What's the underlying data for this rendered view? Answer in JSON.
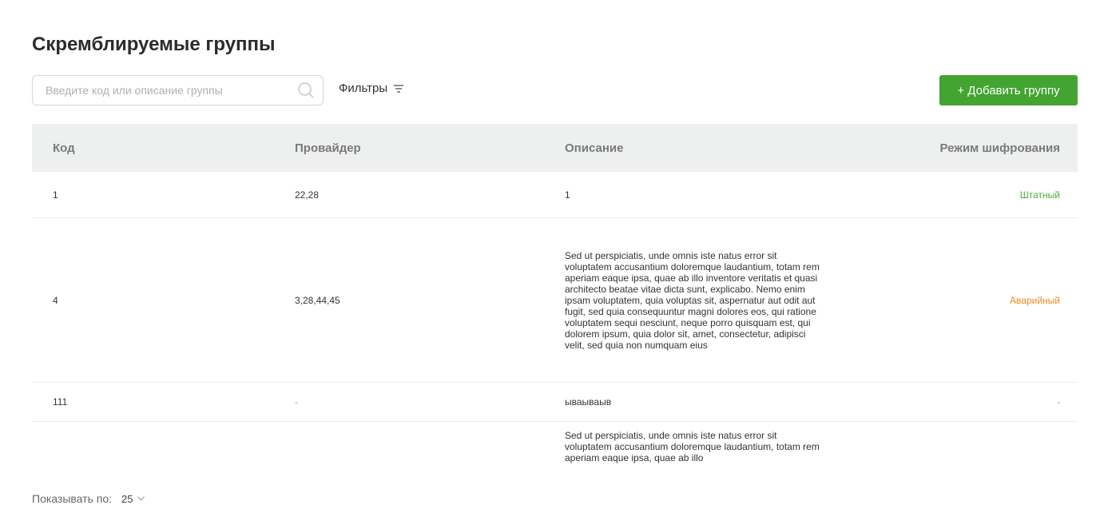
{
  "page": {
    "title": "Скремблируемые группы"
  },
  "toolbar": {
    "search_placeholder": "Введите код или описание группы",
    "filters_label": "Фильтры",
    "add_button_label": "+ Добавить группу"
  },
  "table": {
    "columns": [
      "Код",
      "Провайдер",
      "Описание",
      "Режим шифрования"
    ],
    "rows": [
      {
        "code": "1",
        "provider": "22,28",
        "description": "1",
        "mode": "Штатный"
      },
      {
        "code": "4",
        "provider": "3,28,44,45",
        "description": "Sed ut perspiciatis, unde omnis iste natus error sit voluptatem accusantium doloremque laudantium, totam rem aperiam eaque ipsa, quae ab illo inventore veritatis et quasi architecto beatae vitae dicta sunt, explicabo. Nemo enim ipsam voluptatem, quia voluptas sit, aspernatur aut odit aut fugit, sed quia consequuntur magni dolores eos, qui ratione voluptatem sequi nesciunt, neque porro quisquam est, qui dolorem ipsum, quia dolor sit, amet, consectetur, adipisci velit, sed quia non numquam eius",
        "mode": "Аварийный"
      },
      {
        "code": "111",
        "provider": "-",
        "description": "ываываыв",
        "mode": "-"
      },
      {
        "code": "",
        "provider": "",
        "description": "Sed ut perspiciatis, unde omnis iste natus error sit voluptatem accusantium doloremque laudantium, totam rem aperiam eaque ipsa, quae ab illo",
        "mode": ""
      }
    ]
  },
  "pagination": {
    "label": "Показывать по:",
    "value": "25"
  },
  "colors": {
    "accent": "#43a432",
    "status_ok": "#4caf3a",
    "status_alarm": "#f08a1c"
  }
}
